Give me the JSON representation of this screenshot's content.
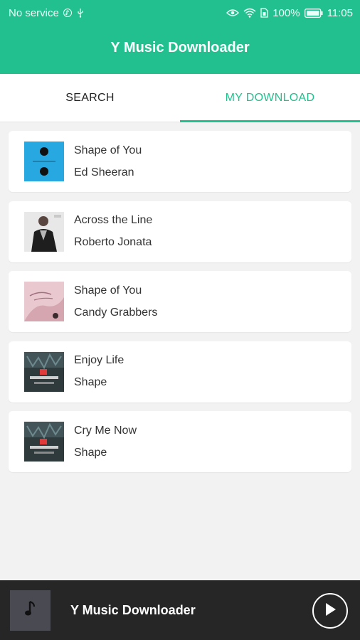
{
  "status_bar": {
    "carrier": "No service",
    "battery": "100%",
    "time": "11:05",
    "icons": [
      "music-note-icon",
      "usb-icon",
      "eye-icon",
      "wifi-icon",
      "sim-icon",
      "battery-icon"
    ]
  },
  "app": {
    "title": "Y Music Downloader",
    "accent_color": "#23c08f"
  },
  "tabs": [
    {
      "label": "SEARCH",
      "active": false
    },
    {
      "label": "MY DOWNLOAD",
      "active": true
    }
  ],
  "downloads": [
    {
      "title": "Shape of You",
      "artist": "Ed Sheeran",
      "art": "divide-album-art"
    },
    {
      "title": "Across the Line",
      "artist": "Roberto Jonata",
      "art": "portrait-album-art"
    },
    {
      "title": "Shape of You",
      "artist": "Candy Grabbers",
      "art": "pink-album-art"
    },
    {
      "title": "Enjoy Life",
      "artist": "Shape",
      "art": "dark-album-art"
    },
    {
      "title": "Cry Me Now",
      "artist": "Shape",
      "art": "dark-album-art"
    }
  ],
  "player": {
    "title": "Y Music Downloader",
    "art_icon": "music-note-icon",
    "control_icon": "play-icon"
  }
}
